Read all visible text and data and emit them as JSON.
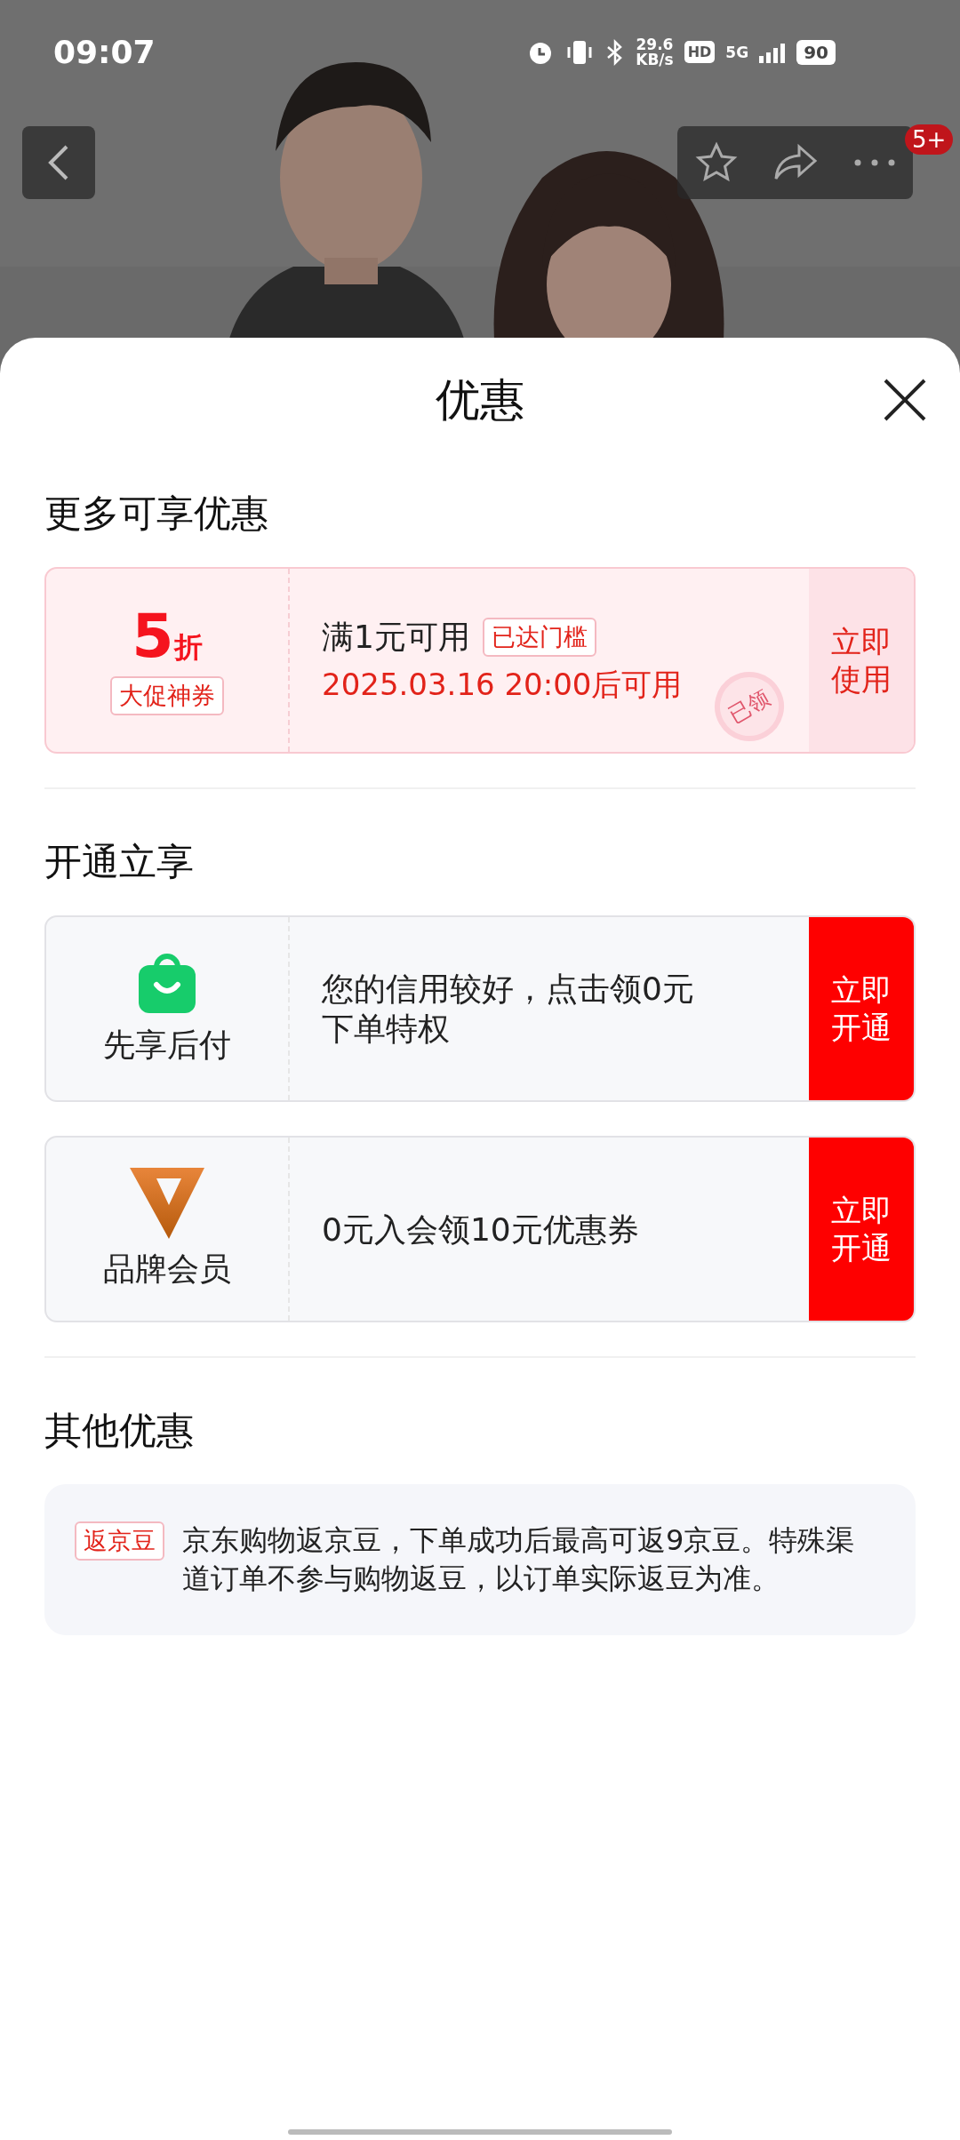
{
  "status_bar": {
    "time": "09:07",
    "net_speed": "29.6",
    "net_unit": "KB/s",
    "hd": "HD",
    "network": "5G",
    "battery": "90"
  },
  "nav": {
    "badge": "5+"
  },
  "sheet": {
    "title": "优惠",
    "sections": [
      {
        "kind": "coupon",
        "title": "更多可享优惠",
        "coupon": {
          "value": "5",
          "unit": "折",
          "tag": "大促神券",
          "condition": "满1元可用",
          "status_tag": "已达门槛",
          "time": "2025.03.16 20:00后可用",
          "stamp": "已领",
          "action": "立即使用"
        }
      },
      {
        "kind": "services",
        "title": "开通立享",
        "items": [
          {
            "kind": "bag",
            "name": "先享后付",
            "desc": "您的信用较好，点击领0元下单特权",
            "action": "立即开通"
          },
          {
            "kind": "v-logo",
            "name": "品牌会员",
            "desc": "0元入会领10元优惠券",
            "action": "立即开通"
          }
        ]
      },
      {
        "kind": "notes",
        "title": "其他优惠",
        "items": [
          {
            "tag": "返京豆",
            "text": "京东购物返京豆，下单成功后最高可返9京豆。特殊渠道订单不参与购物返豆，以订单实际返豆为准。"
          }
        ]
      }
    ]
  }
}
